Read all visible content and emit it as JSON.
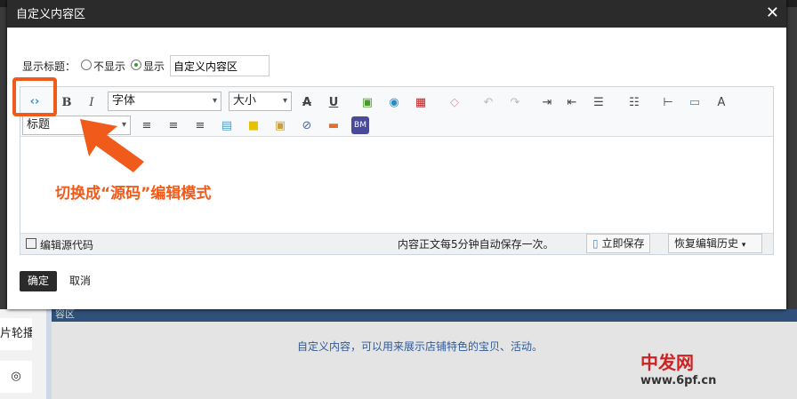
{
  "dialog": {
    "title": "自定义内容区",
    "close": "✕"
  },
  "show_title": {
    "label": "显示标题：",
    "options": [
      "不显示",
      "显示"
    ],
    "selected": "显示",
    "value": "自定义内容区"
  },
  "toolbar": {
    "font": "字体",
    "size": "大小",
    "heading": "标题"
  },
  "footer": {
    "source_checkbox": "编辑源代码",
    "autosave": "内容正文每5分钟自动保存一次。",
    "save_now": "立即保存",
    "restore": "恢复编辑历史"
  },
  "actions": {
    "ok": "确定",
    "cancel": "取消"
  },
  "annotation": {
    "text": "切换成“源码”编辑模式",
    "color": "#f05a1a"
  },
  "background": {
    "bar_label": "容区",
    "sidebar_item": "片轮播",
    "content_text": "自定义内容，可以用来展示店铺特色的宝贝、活动。"
  },
  "watermark": {
    "text": "中发网 www.6pf.cn"
  }
}
